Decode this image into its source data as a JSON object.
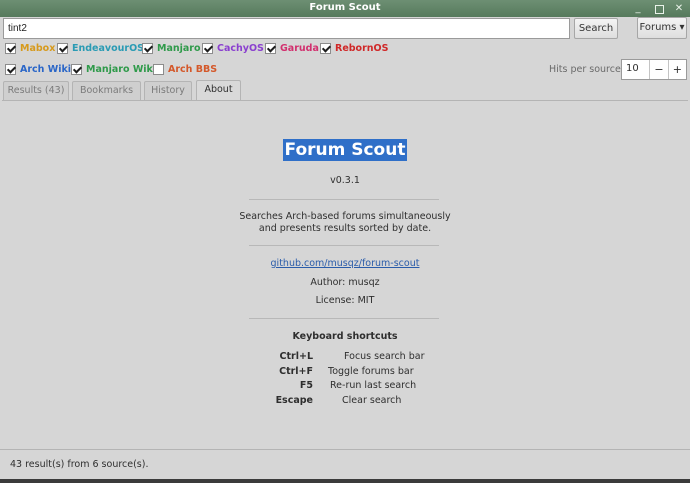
{
  "window": {
    "title": "Forum Scout"
  },
  "search": {
    "value": "tint2",
    "button_label": "Search",
    "forums_label": "Forums ▾"
  },
  "sources": [
    {
      "label": "Mabox",
      "checked": true,
      "color": "#d79a1c"
    },
    {
      "label": "EndeavourOS",
      "checked": true,
      "color": "#2a9bb4"
    },
    {
      "label": "Manjaro",
      "checked": true,
      "color": "#2f9a4a"
    },
    {
      "label": "CachyOS",
      "checked": true,
      "color": "#8a3fcf"
    },
    {
      "label": "Garuda",
      "checked": true,
      "color": "#d22f6e"
    },
    {
      "label": "RebornOS",
      "checked": true,
      "color": "#d02828"
    },
    {
      "label": "Arch Wiki",
      "checked": true,
      "color": "#2a66c8"
    },
    {
      "label": "Manjaro Wiki",
      "checked": true,
      "color": "#2f9a4a"
    },
    {
      "label": "Arch BBS",
      "checked": false,
      "color": "#d4582a"
    }
  ],
  "hits": {
    "label": "Hits per source:",
    "value": "10",
    "minus": "−",
    "plus": "+"
  },
  "tabs": [
    {
      "label": "Results (43)",
      "active": false
    },
    {
      "label": "Bookmarks",
      "active": false
    },
    {
      "label": "History",
      "active": false
    },
    {
      "label": "About",
      "active": true
    }
  ],
  "about": {
    "name": "Forum Scout",
    "version": "v0.3.1",
    "description_line1": "Searches Arch-based forums simultaneously",
    "description_line2": "and presents results sorted by date.",
    "link": "github.com/musqz/forum-scout",
    "author": "Author: musqz",
    "license": "License: MIT",
    "shortcuts_title": "Keyboard shortcuts",
    "shortcuts": [
      {
        "key": "Ctrl+L",
        "action": "Focus search bar"
      },
      {
        "key": "Ctrl+F",
        "action": "Toggle forums bar"
      },
      {
        "key": "F5",
        "action": "Re-run last search"
      },
      {
        "key": "Escape",
        "action": "Clear search"
      }
    ]
  },
  "status": {
    "text": "43 result(s) from 6 source(s)."
  }
}
